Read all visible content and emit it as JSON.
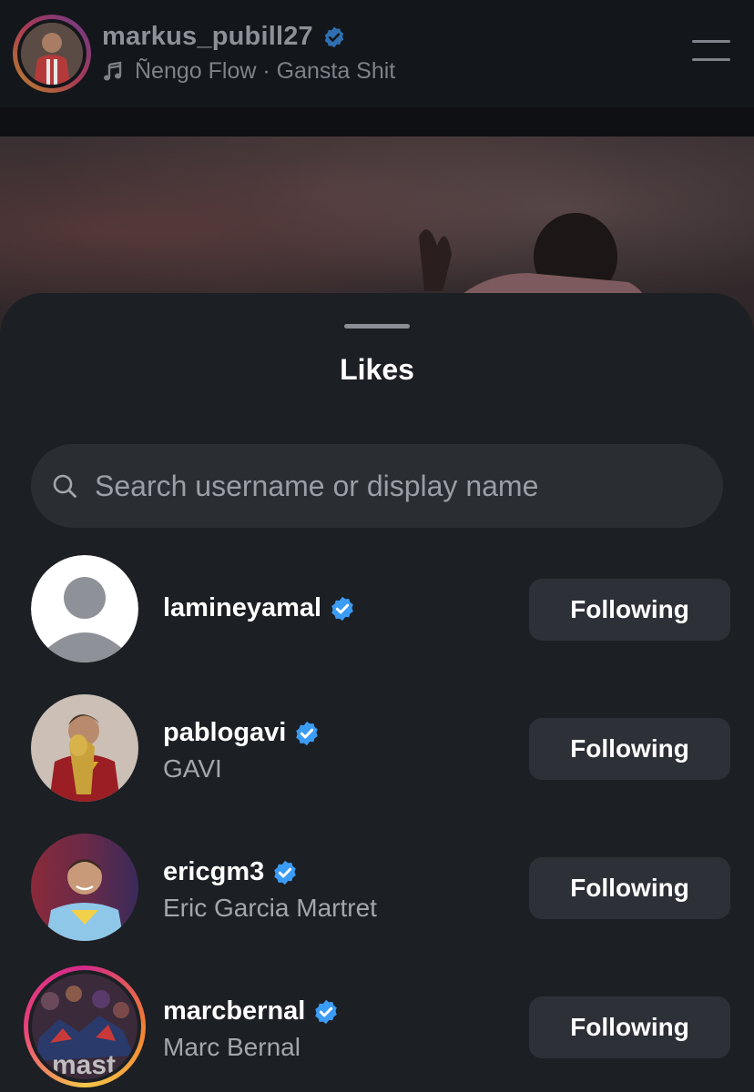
{
  "header": {
    "username": "markus_pubill27",
    "music_text": "Ñengo Flow · Gansta Shit"
  },
  "sheet": {
    "title": "Likes",
    "search": {
      "placeholder": "Search username or display name",
      "value": ""
    }
  },
  "likes": [
    {
      "username": "lamineyamal",
      "display_name": "",
      "verified": true,
      "button_label": "Following",
      "avatar": "default-avatar"
    },
    {
      "username": "pablogavi",
      "display_name": "GAVI",
      "verified": true,
      "button_label": "Following",
      "avatar": "photo"
    },
    {
      "username": "ericgm3",
      "display_name": "Eric Garcia Martret",
      "verified": true,
      "button_label": "Following",
      "avatar": "photo"
    },
    {
      "username": "marcbernal",
      "display_name": "Marc Bernal",
      "verified": true,
      "button_label": "Following",
      "avatar": "photo-story-ring"
    }
  ],
  "colors": {
    "sheet_bg": "#1c1f23",
    "button_bg": "#2d3036",
    "verified_blue": "#3b9cf5",
    "secondary_text": "#a3a7ad"
  }
}
